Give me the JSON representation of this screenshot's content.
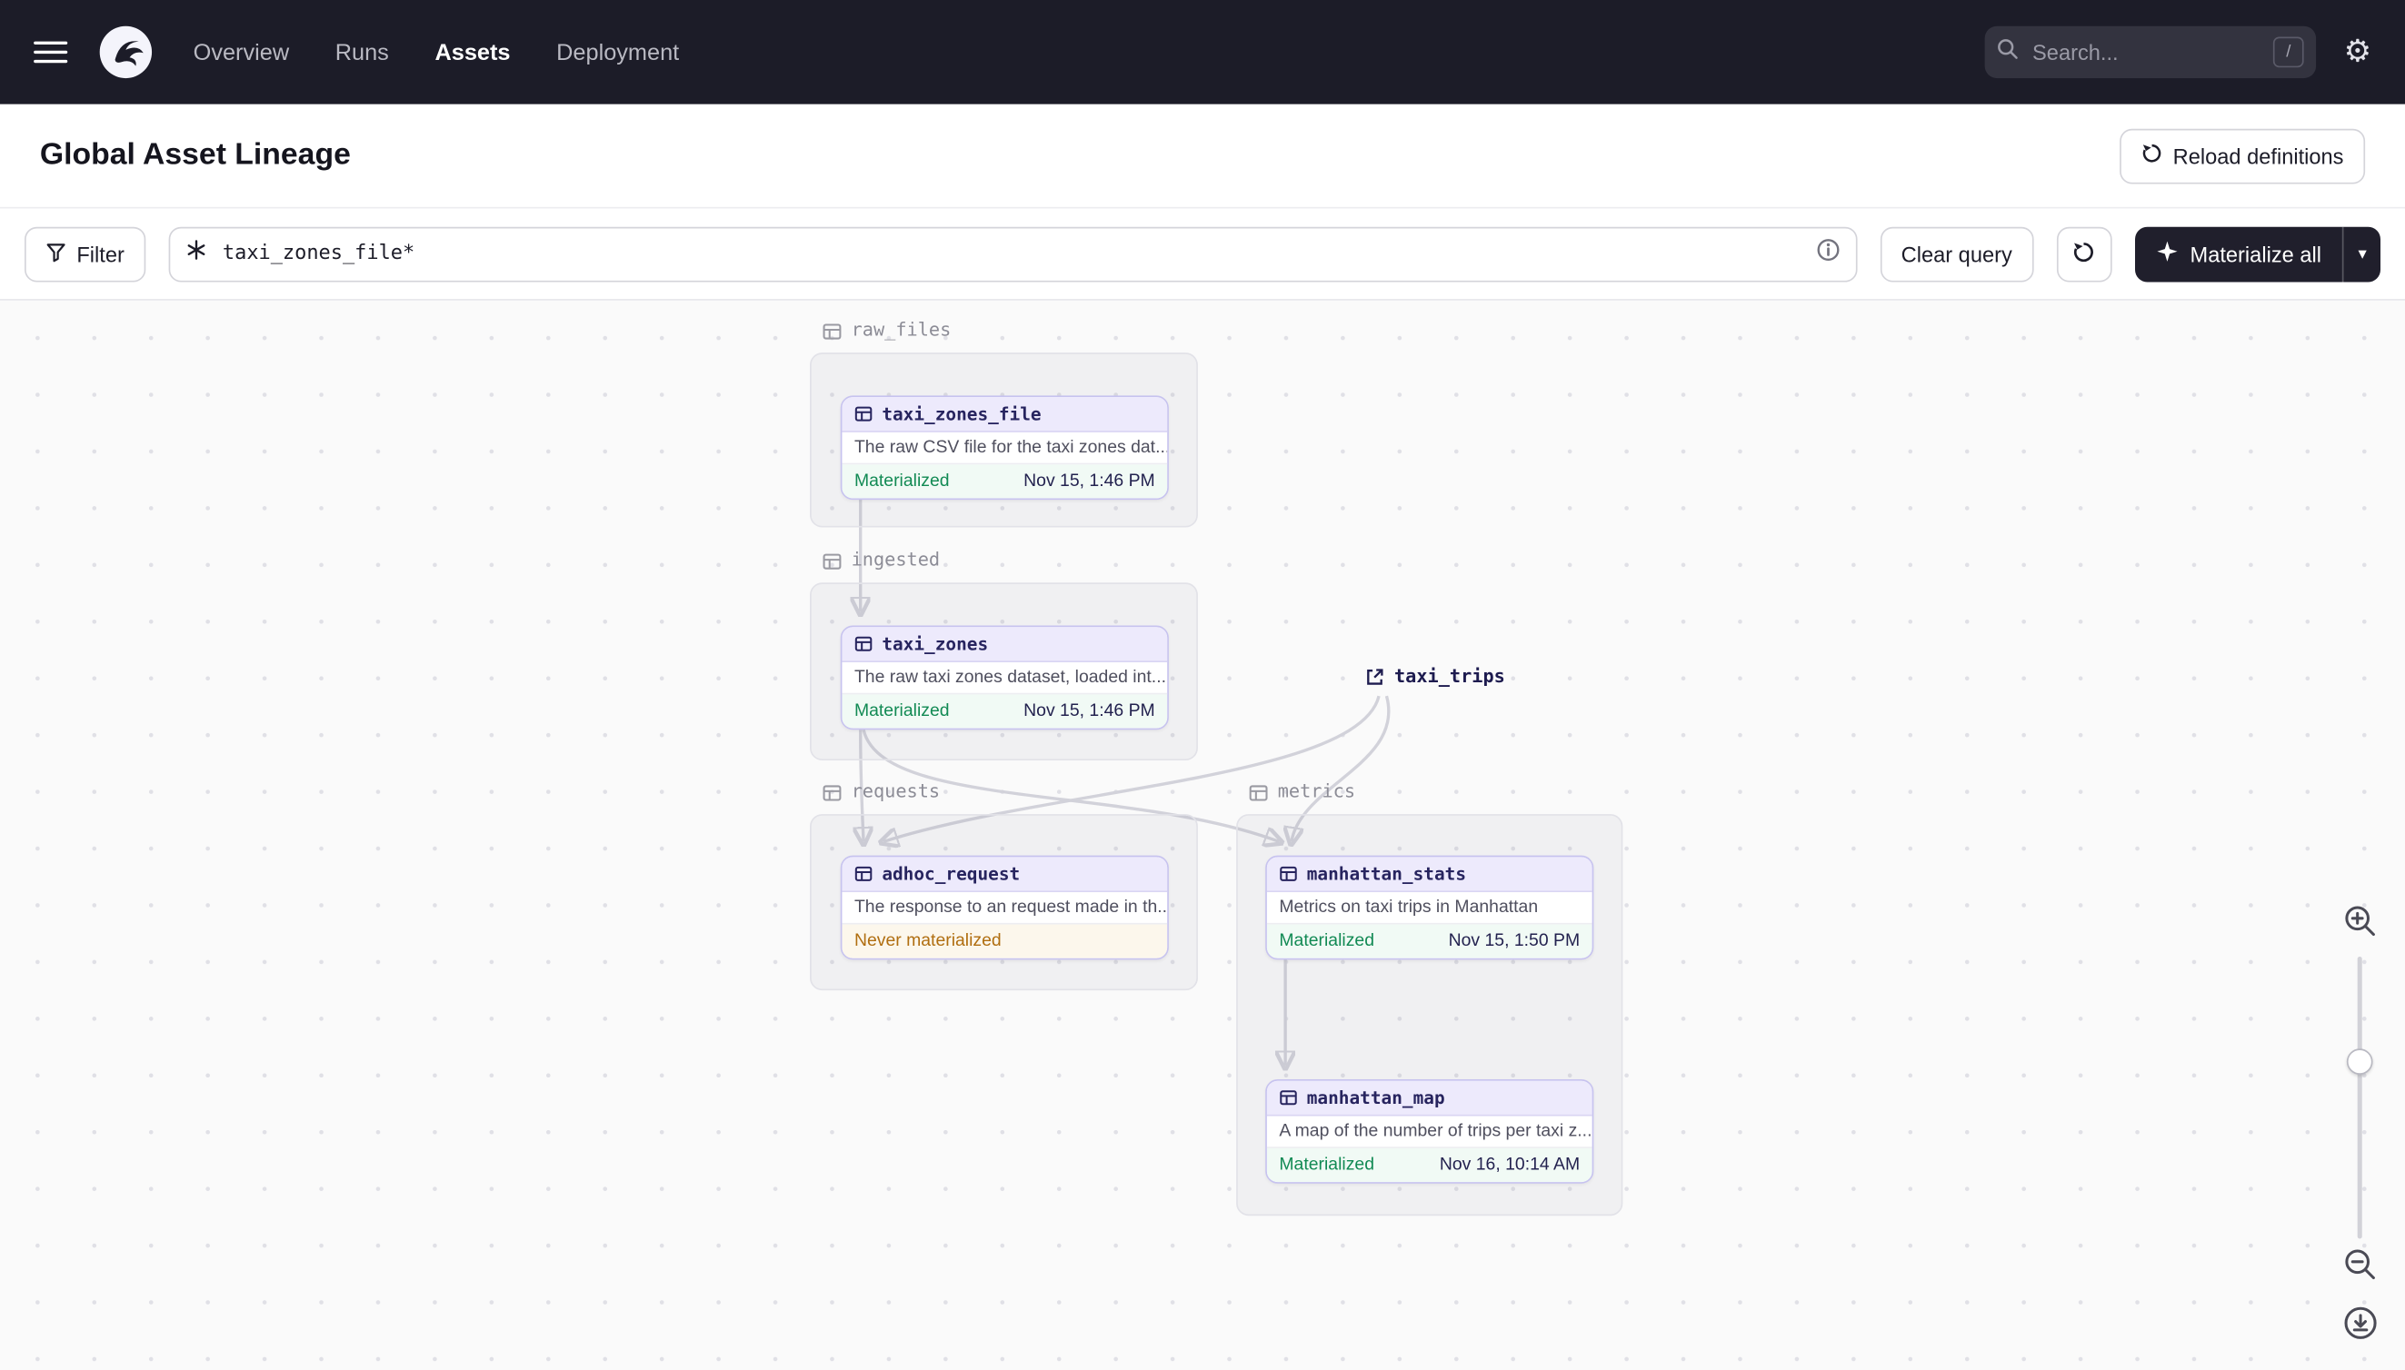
{
  "colors": {
    "nav_bg": "#1c1c28",
    "node_border_purple": "#c7c3ef",
    "materialized_green": "#128a54",
    "never_materialized_orange": "#b06e10"
  },
  "navbar": {
    "items": [
      {
        "label": "Overview"
      },
      {
        "label": "Runs"
      },
      {
        "label": "Assets"
      },
      {
        "label": "Deployment"
      }
    ],
    "search_placeholder": "Search...",
    "search_shortcut": "/"
  },
  "header": {
    "title": "Global Asset Lineage",
    "reload_label": "Reload definitions"
  },
  "toolbar": {
    "filter_label": "Filter",
    "query_value": "taxi_zones_file*",
    "clear_label": "Clear query",
    "materialize_label": "Materialize all"
  },
  "graph": {
    "groups": [
      {
        "name": "raw_files"
      },
      {
        "name": "ingested"
      },
      {
        "name": "requests"
      },
      {
        "name": "metrics"
      }
    ],
    "external": {
      "label": "taxi_trips"
    },
    "nodes": [
      {
        "title": "taxi_zones_file",
        "description": "The raw CSV file for the taxi zones dat...",
        "status": "Materialized",
        "timestamp": "Nov 15, 1:46 PM"
      },
      {
        "title": "taxi_zones",
        "description": "The raw taxi zones dataset, loaded int...",
        "status": "Materialized",
        "timestamp": "Nov 15, 1:46 PM"
      },
      {
        "title": "adhoc_request",
        "description": "The response to an request made in th...",
        "status": "Never materialized",
        "timestamp": ""
      },
      {
        "title": "manhattan_stats",
        "description": "Metrics on taxi trips in Manhattan",
        "status": "Materialized",
        "timestamp": "Nov 15, 1:50 PM"
      },
      {
        "title": "manhattan_map",
        "description": "A map of the number of trips per taxi z...",
        "status": "Materialized",
        "timestamp": "Nov 16, 10:14 AM"
      }
    ]
  }
}
